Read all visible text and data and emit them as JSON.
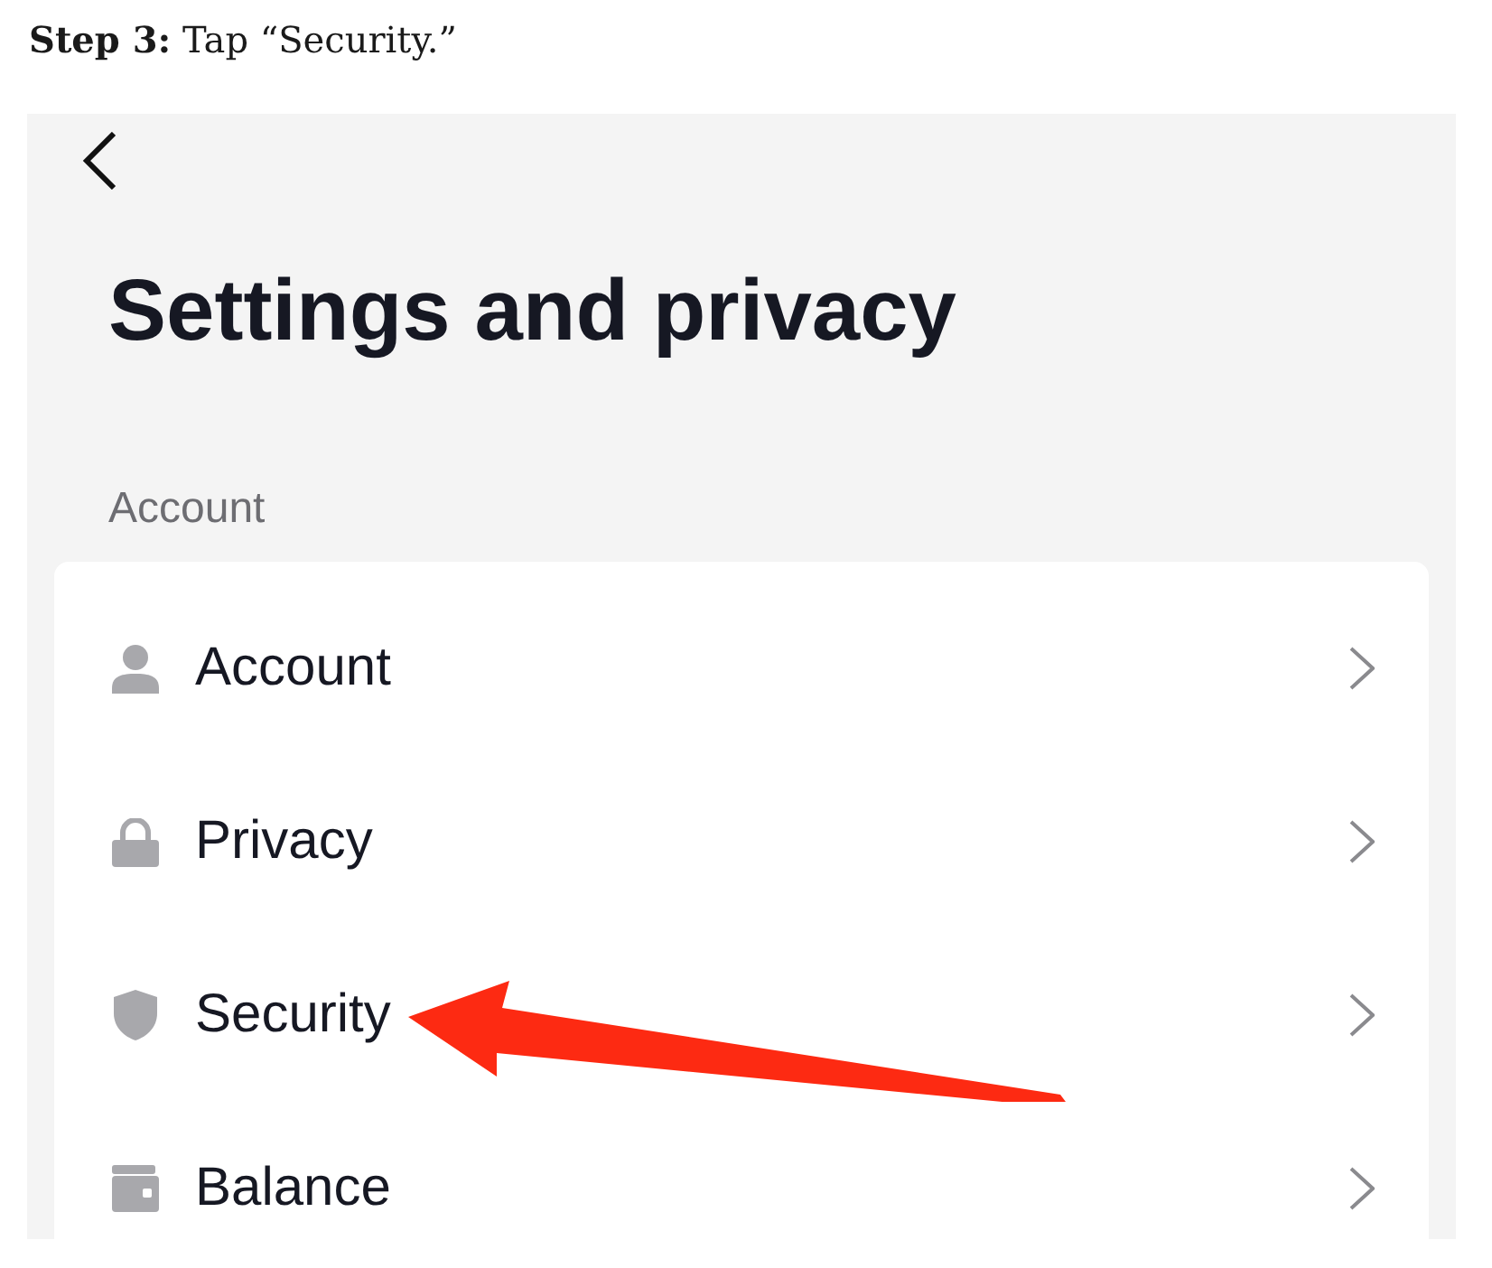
{
  "instruction": "**Step 3:** Tap “Security.”",
  "screen": {
    "title": "Settings and privacy",
    "section_label": "Account",
    "items": [
      {
        "label": "Account",
        "arrow": false
      },
      {
        "label": "Privacy",
        "arrow": false
      },
      {
        "label": "Security",
        "arrow": true
      },
      {
        "label": "Balance",
        "arrow": false
      }
    ]
  }
}
